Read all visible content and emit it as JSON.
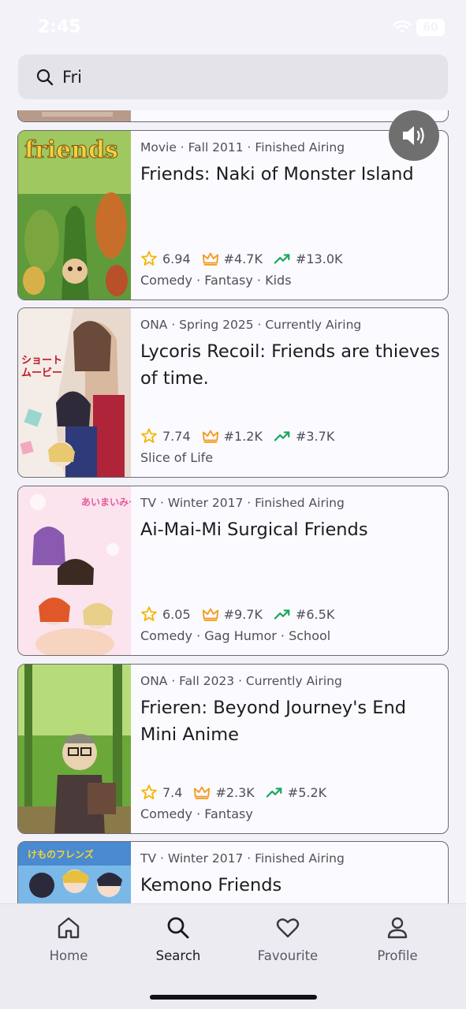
{
  "status_bar": {
    "time": "2:45",
    "battery": "60"
  },
  "search": {
    "value": "Fri",
    "icon": "search-icon"
  },
  "results": [
    {
      "meta": "Movie · Fall 2011 · Finished Airing",
      "title": "Friends: Naki of Monster Island",
      "score": "6.94",
      "rank": "#4.7K",
      "popularity": "#13.0K",
      "genres": "Comedy · Fantasy · Kids"
    },
    {
      "meta": "ONA · Spring 2025 · Currently Airing",
      "title": "Lycoris Recoil: Friends are thieves of time.",
      "score": "7.74",
      "rank": "#1.2K",
      "popularity": "#3.7K",
      "genres": "Slice of Life"
    },
    {
      "meta": "TV · Winter 2017 · Finished Airing",
      "title": "Ai-Mai-Mi Surgical Friends",
      "score": "6.05",
      "rank": "#9.7K",
      "popularity": "#6.5K",
      "genres": "Comedy · Gag Humor · School"
    },
    {
      "meta": "ONA · Fall 2023 · Currently Airing",
      "title": "Frieren: Beyond Journey's End Mini Anime",
      "score": "7.4",
      "rank": "#2.3K",
      "popularity": "#5.2K",
      "genres": "Comedy · Fantasy"
    },
    {
      "meta": "TV · Winter 2017 · Finished Airing",
      "title": "Kemono Friends"
    }
  ],
  "nav": {
    "items": [
      {
        "label": "Home",
        "icon": "home-icon"
      },
      {
        "label": "Search",
        "icon": "search-icon"
      },
      {
        "label": "Favourite",
        "icon": "heart-icon"
      },
      {
        "label": "Profile",
        "icon": "user-icon"
      }
    ],
    "active": "Search"
  },
  "colors": {
    "background": "#f3f2f8",
    "star": "#f2b600",
    "crown": "#f39a1c",
    "trend": "#19a85a",
    "card_border": "#6c6a72"
  }
}
